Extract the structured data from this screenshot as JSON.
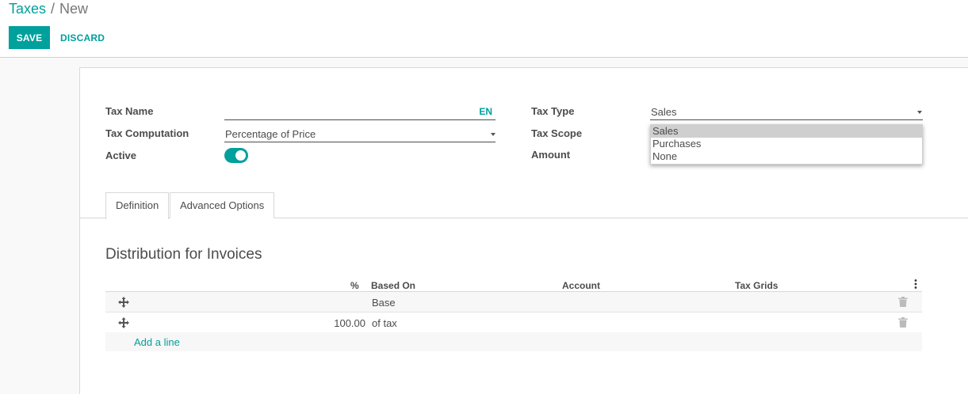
{
  "breadcrumb": {
    "parent": "Taxes",
    "separator": "/",
    "current": "New"
  },
  "toolbar": {
    "save_label": "SAVE",
    "discard_label": "DISCARD"
  },
  "form": {
    "tax_name": {
      "label": "Tax Name",
      "value": "",
      "lang": "EN"
    },
    "tax_computation": {
      "label": "Tax Computation",
      "value": "Percentage of Price"
    },
    "active": {
      "label": "Active",
      "value": true
    },
    "tax_type": {
      "label": "Tax Type",
      "value": "Sales",
      "options": [
        "Sales",
        "Purchases",
        "None"
      ]
    },
    "tax_scope": {
      "label": "Tax Scope"
    },
    "amount": {
      "label": "Amount"
    }
  },
  "tabs": [
    {
      "label": "Definition",
      "active": true
    },
    {
      "label": "Advanced Options",
      "active": false
    }
  ],
  "distribution": {
    "title": "Distribution for Invoices",
    "columns": [
      "%",
      "Based On",
      "Account",
      "Tax Grids"
    ],
    "rows": [
      {
        "percent": "",
        "based_on": "Base",
        "account": "",
        "tax_grids": ""
      },
      {
        "percent": "100.00",
        "based_on": "of tax",
        "account": "",
        "tax_grids": ""
      }
    ],
    "add_line": "Add a line"
  },
  "icons": {
    "handle": "move-handle-icon",
    "trash": "trash-icon",
    "kebab": "kebab-menu-icon",
    "caret": "caret-down-icon"
  },
  "colors": {
    "accent": "#00a09d",
    "text": "#4c4c4c"
  }
}
